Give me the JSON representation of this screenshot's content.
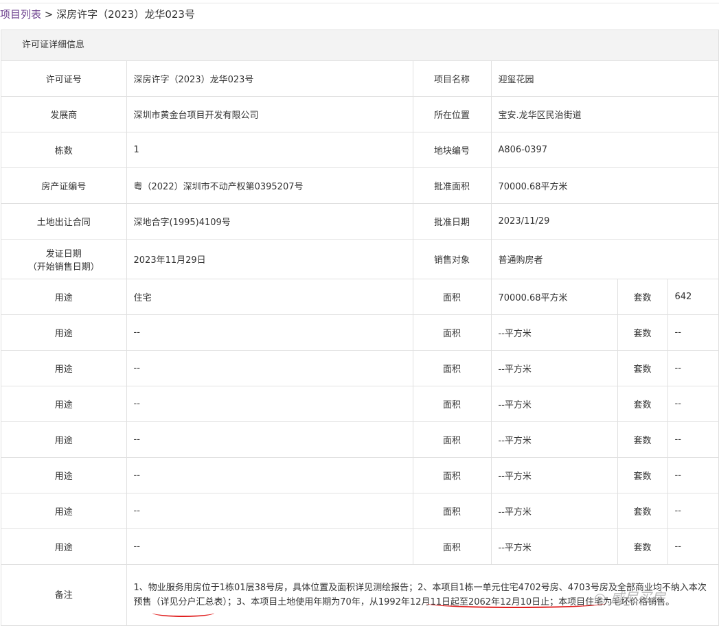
{
  "breadcrumb": {
    "link": "项目列表",
    "sep": ">",
    "current": "深房许字（2023）龙华023号"
  },
  "panel_title": "许可证详细信息",
  "info": [
    {
      "l1": "许可证号",
      "v1": "深房许字（2023）龙华023号",
      "l2": "项目名称",
      "v2": "迎玺花园"
    },
    {
      "l1": "发展商",
      "v1": "深圳市黄金台项目开发有限公司",
      "l2": "所在位置",
      "v2": "宝安.龙华区民治街道"
    },
    {
      "l1": "栋数",
      "v1": "1",
      "l2": "地块编号",
      "v2": "A806-0397"
    },
    {
      "l1": "房产证编号",
      "v1": "粤（2022）深圳市不动产权第0395207号",
      "l2": "批准面积",
      "v2": "70000.68平方米"
    },
    {
      "l1": "土地出让合同",
      "v1": "深地合字(1995)4109号",
      "l2": "批准日期",
      "v2": "2023/11/29"
    },
    {
      "l1": "发证日期\n（开始销售日期）",
      "v1": "2023年11月29日",
      "l2": "销售对象",
      "v2": "普通购房者"
    }
  ],
  "usage": [
    {
      "l1": "用途",
      "v1": "住宅",
      "l2": "面积",
      "v2": "70000.68平方米",
      "l3": "套数",
      "v3": "642"
    },
    {
      "l1": "用途",
      "v1": "--",
      "l2": "面积",
      "v2": "--平方米",
      "l3": "套数",
      "v3": "--"
    },
    {
      "l1": "用途",
      "v1": "--",
      "l2": "面积",
      "v2": "--平方米",
      "l3": "套数",
      "v3": "--"
    },
    {
      "l1": "用途",
      "v1": "--",
      "l2": "面积",
      "v2": "--平方米",
      "l3": "套数",
      "v3": "--"
    },
    {
      "l1": "用途",
      "v1": "--",
      "l2": "面积",
      "v2": "--平方米",
      "l3": "套数",
      "v3": "--"
    },
    {
      "l1": "用途",
      "v1": "--",
      "l2": "面积",
      "v2": "--平方米",
      "l3": "套数",
      "v3": "--"
    },
    {
      "l1": "用途",
      "v1": "--",
      "l2": "面积",
      "v2": "--平方米",
      "l3": "套数",
      "v3": "--"
    },
    {
      "l1": "用途",
      "v1": "--",
      "l2": "面积",
      "v2": "--平方米",
      "l3": "套数",
      "v3": "--"
    }
  ],
  "remark": {
    "label": "备注",
    "text": "1、物业服务用房位于1栋01层38号房，具体位置及面积详见测绘报告；2、本项目1栋一单元住宅4702号房、4703号房及全部商业均不纳入本次预售（详见分户汇总表）；3、本项目土地使用年期为70年，从1992年12月11日起至2062年12月10日止；本项目住宅为毛坯价格销售。"
  },
  "watermark": "威尼买房"
}
